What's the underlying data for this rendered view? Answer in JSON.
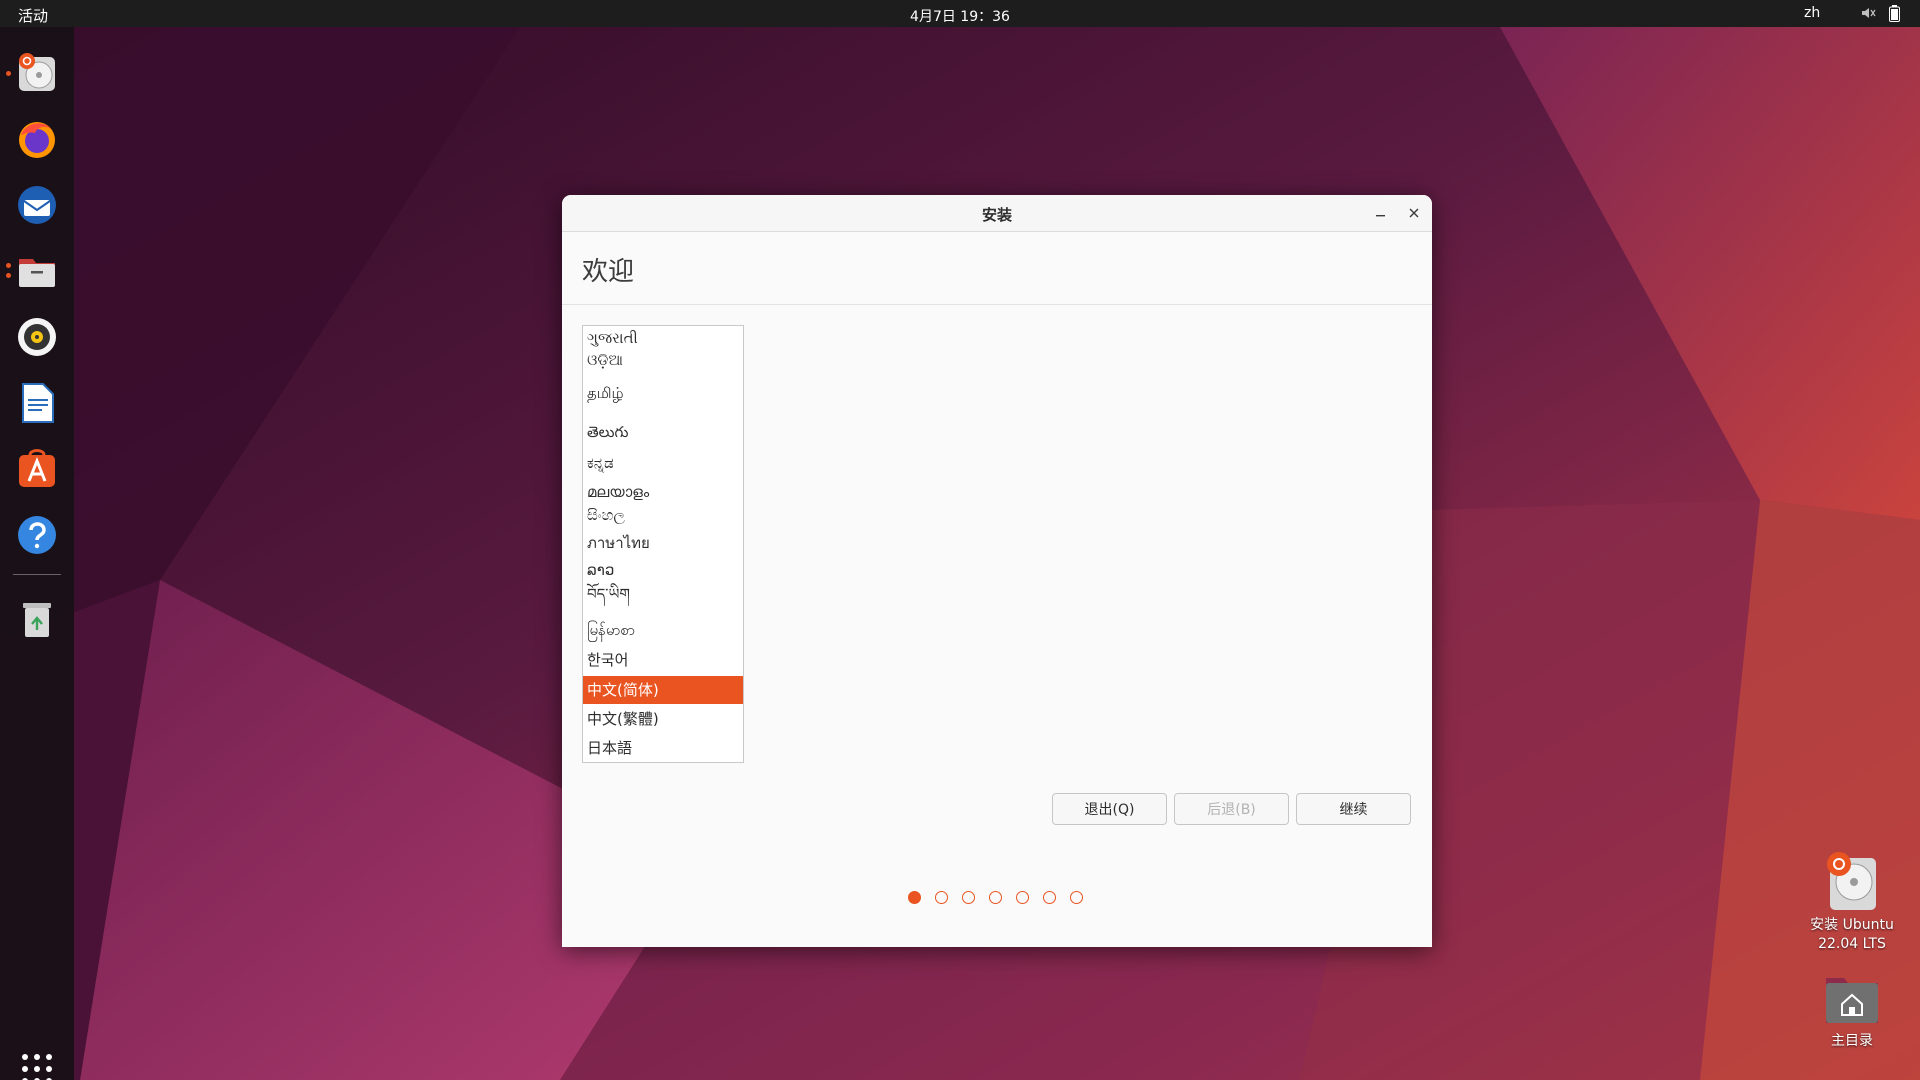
{
  "topbar": {
    "activities": "活动",
    "clock": "4月7日 19：36",
    "input_method": "zh",
    "volume_icon": "volume-muted-icon",
    "battery_icon": "battery-icon"
  },
  "dock": {
    "items": [
      {
        "name": "ubuntu-installer",
        "icon": "installer-disc-icon",
        "running": true
      },
      {
        "name": "firefox",
        "icon": "firefox-icon",
        "running": false
      },
      {
        "name": "thunderbird",
        "icon": "thunderbird-icon",
        "running": false
      },
      {
        "name": "files",
        "icon": "files-icon",
        "running": true
      },
      {
        "name": "rhythmbox",
        "icon": "rhythmbox-icon",
        "running": false
      },
      {
        "name": "libreoffice-writer",
        "icon": "writer-icon",
        "running": false
      },
      {
        "name": "app-center",
        "icon": "app-center-icon",
        "running": false
      },
      {
        "name": "help",
        "icon": "help-icon",
        "running": false
      },
      {
        "name": "trash",
        "icon": "trash-icon",
        "running": false
      }
    ],
    "show_apps_icon": "grid-icon"
  },
  "desktop": {
    "installer_label_1": "安装 Ubuntu",
    "installer_label_2": "22.04 LTS",
    "home_label": "主目录"
  },
  "window": {
    "title": "安装",
    "heading": "欢迎",
    "languages": [
      "ગુજરાતી",
      "ଓଡ଼ିଆ",
      "தமிழ்",
      "తెలుగు",
      "ಕನ್ನಡ",
      "മലയാളം",
      "සිංහල",
      "ภาษาไทย",
      "ລາວ",
      "བོད་ཡིག",
      "မြန်မာစာ",
      "한국어",
      "中文(简体)",
      "中文(繁體)",
      "日本語"
    ],
    "selected_language": "中文(简体)",
    "buttons": {
      "quit": "退出(Q)",
      "back": "后退(B)",
      "continue": "继续"
    },
    "progress": {
      "total_steps": 7,
      "current_step": 1
    }
  },
  "colors": {
    "accent": "#e95420",
    "topbar_bg": "#1d1d1d",
    "window_bg": "#fafafa"
  }
}
